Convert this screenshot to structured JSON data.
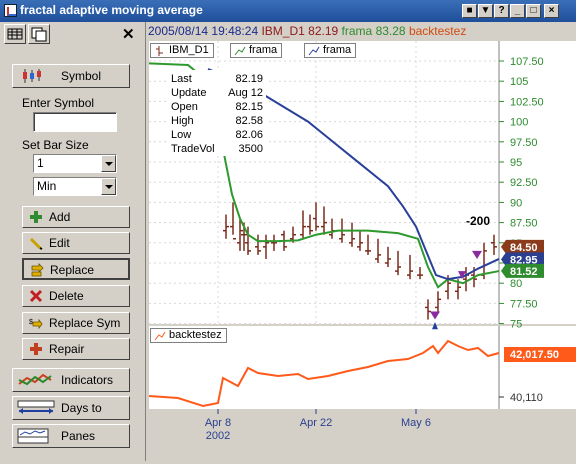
{
  "window": {
    "title": "fractal adaptive moving average",
    "controls": [
      "minimize-pane-button",
      "restore-pane-button",
      "help-button",
      "minimize-button",
      "maximize-button",
      "close-button"
    ]
  },
  "sidebar": {
    "symbol_button": "Symbol",
    "enter_symbol_label": "Enter Symbol",
    "symbol_value": "",
    "bar_size_label": "Set Bar Size",
    "bar_size_value": "1",
    "bar_unit_value": "Min",
    "actions": [
      "Add",
      "Edit",
      "Replace",
      "Delete",
      "Replace Sym",
      "Repair"
    ],
    "nav": [
      "Indicators",
      "Days to Load",
      "Panes"
    ]
  },
  "header": {
    "date": "2005/08/14",
    "time": "19:48:24",
    "symbol": "IBM_D1",
    "symbol_value": "82.19",
    "frama_label": "frama",
    "frama_value": "83.28",
    "backtest_label": "backtestez"
  },
  "legend": {
    "symbol": "IBM_D1",
    "frama1": "frama",
    "frama2": "frama",
    "backtest": "backtestez"
  },
  "data_panel": [
    {
      "key": "Last",
      "value": "82.19"
    },
    {
      "key": "Update",
      "value": "Aug 12"
    },
    {
      "key": "Open",
      "value": "82.15"
    },
    {
      "key": "High",
      "value": "82.58"
    },
    {
      "key": "Low",
      "value": "82.06"
    },
    {
      "key": "TradeVol",
      "value": "3500"
    }
  ],
  "chart": {
    "price_ticks": [
      "107.50",
      "105",
      "102.50",
      "100",
      "97.50",
      "95",
      "92.50",
      "90",
      "87.50",
      "85",
      "82.50",
      "80",
      "77.50",
      "75"
    ],
    "price_badges": [
      {
        "label": "84.50",
        "color": "#8b3a1a"
      },
      {
        "label": "82.95",
        "color": "#2a3f8f"
      },
      {
        "label": "81.52",
        "color": "#2e8b2e"
      }
    ],
    "annotation": "-200",
    "equity_ticks": [
      "40,110"
    ],
    "equity_badge": "42,017.50",
    "x_ticks": [
      "Apr 8",
      "Apr 22",
      "May 6"
    ],
    "x_year": "2002",
    "colors": {
      "frama_fast": "#2e9a2e",
      "frama_slow": "#2a3f9a",
      "equity": "#ff5a1a",
      "bars": "#7a2a1a"
    }
  }
}
